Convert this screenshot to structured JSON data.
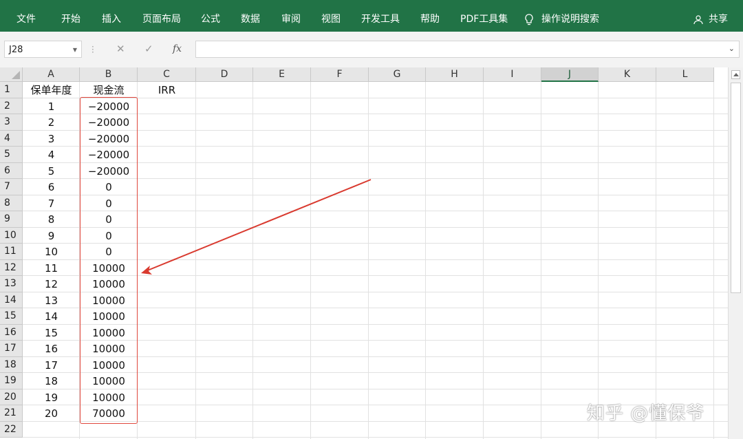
{
  "ribbon": {
    "tabs": [
      "文件",
      "开始",
      "插入",
      "页面布局",
      "公式",
      "数据",
      "审阅",
      "视图",
      "开发工具",
      "帮助",
      "PDF工具集"
    ],
    "search_label": "操作说明搜索",
    "share_label": "共享",
    "color": "#217346"
  },
  "formula_bar": {
    "name_box": "J28",
    "cancel_icon": "✕",
    "enter_icon": "✓",
    "fx_label": "fx",
    "formula": ""
  },
  "sheet": {
    "columns": [
      "A",
      "B",
      "C",
      "D",
      "E",
      "F",
      "G",
      "H",
      "I",
      "J",
      "K",
      "L"
    ],
    "selected_column": "J",
    "row_numbers": [
      "1",
      "2",
      "3",
      "4",
      "5",
      "6",
      "7",
      "8",
      "9",
      "10",
      "11",
      "12",
      "13",
      "14",
      "15",
      "16",
      "17",
      "18",
      "19",
      "20",
      "21",
      "22"
    ],
    "headers": {
      "A1": "保单年度",
      "B1": "现金流",
      "C1": "IRR"
    },
    "years": [
      "1",
      "2",
      "3",
      "4",
      "5",
      "6",
      "7",
      "8",
      "9",
      "10",
      "11",
      "12",
      "13",
      "14",
      "15",
      "16",
      "17",
      "18",
      "19",
      "20"
    ],
    "cashflows": [
      "−20000",
      "−20000",
      "−20000",
      "−20000",
      "−20000",
      "0",
      "0",
      "0",
      "0",
      "0",
      "10000",
      "10000",
      "10000",
      "10000",
      "10000",
      "10000",
      "10000",
      "10000",
      "10000",
      "70000"
    ]
  },
  "annotation": {
    "highlight_color": "#e0473c"
  },
  "watermark": "知乎 @懂保爷"
}
